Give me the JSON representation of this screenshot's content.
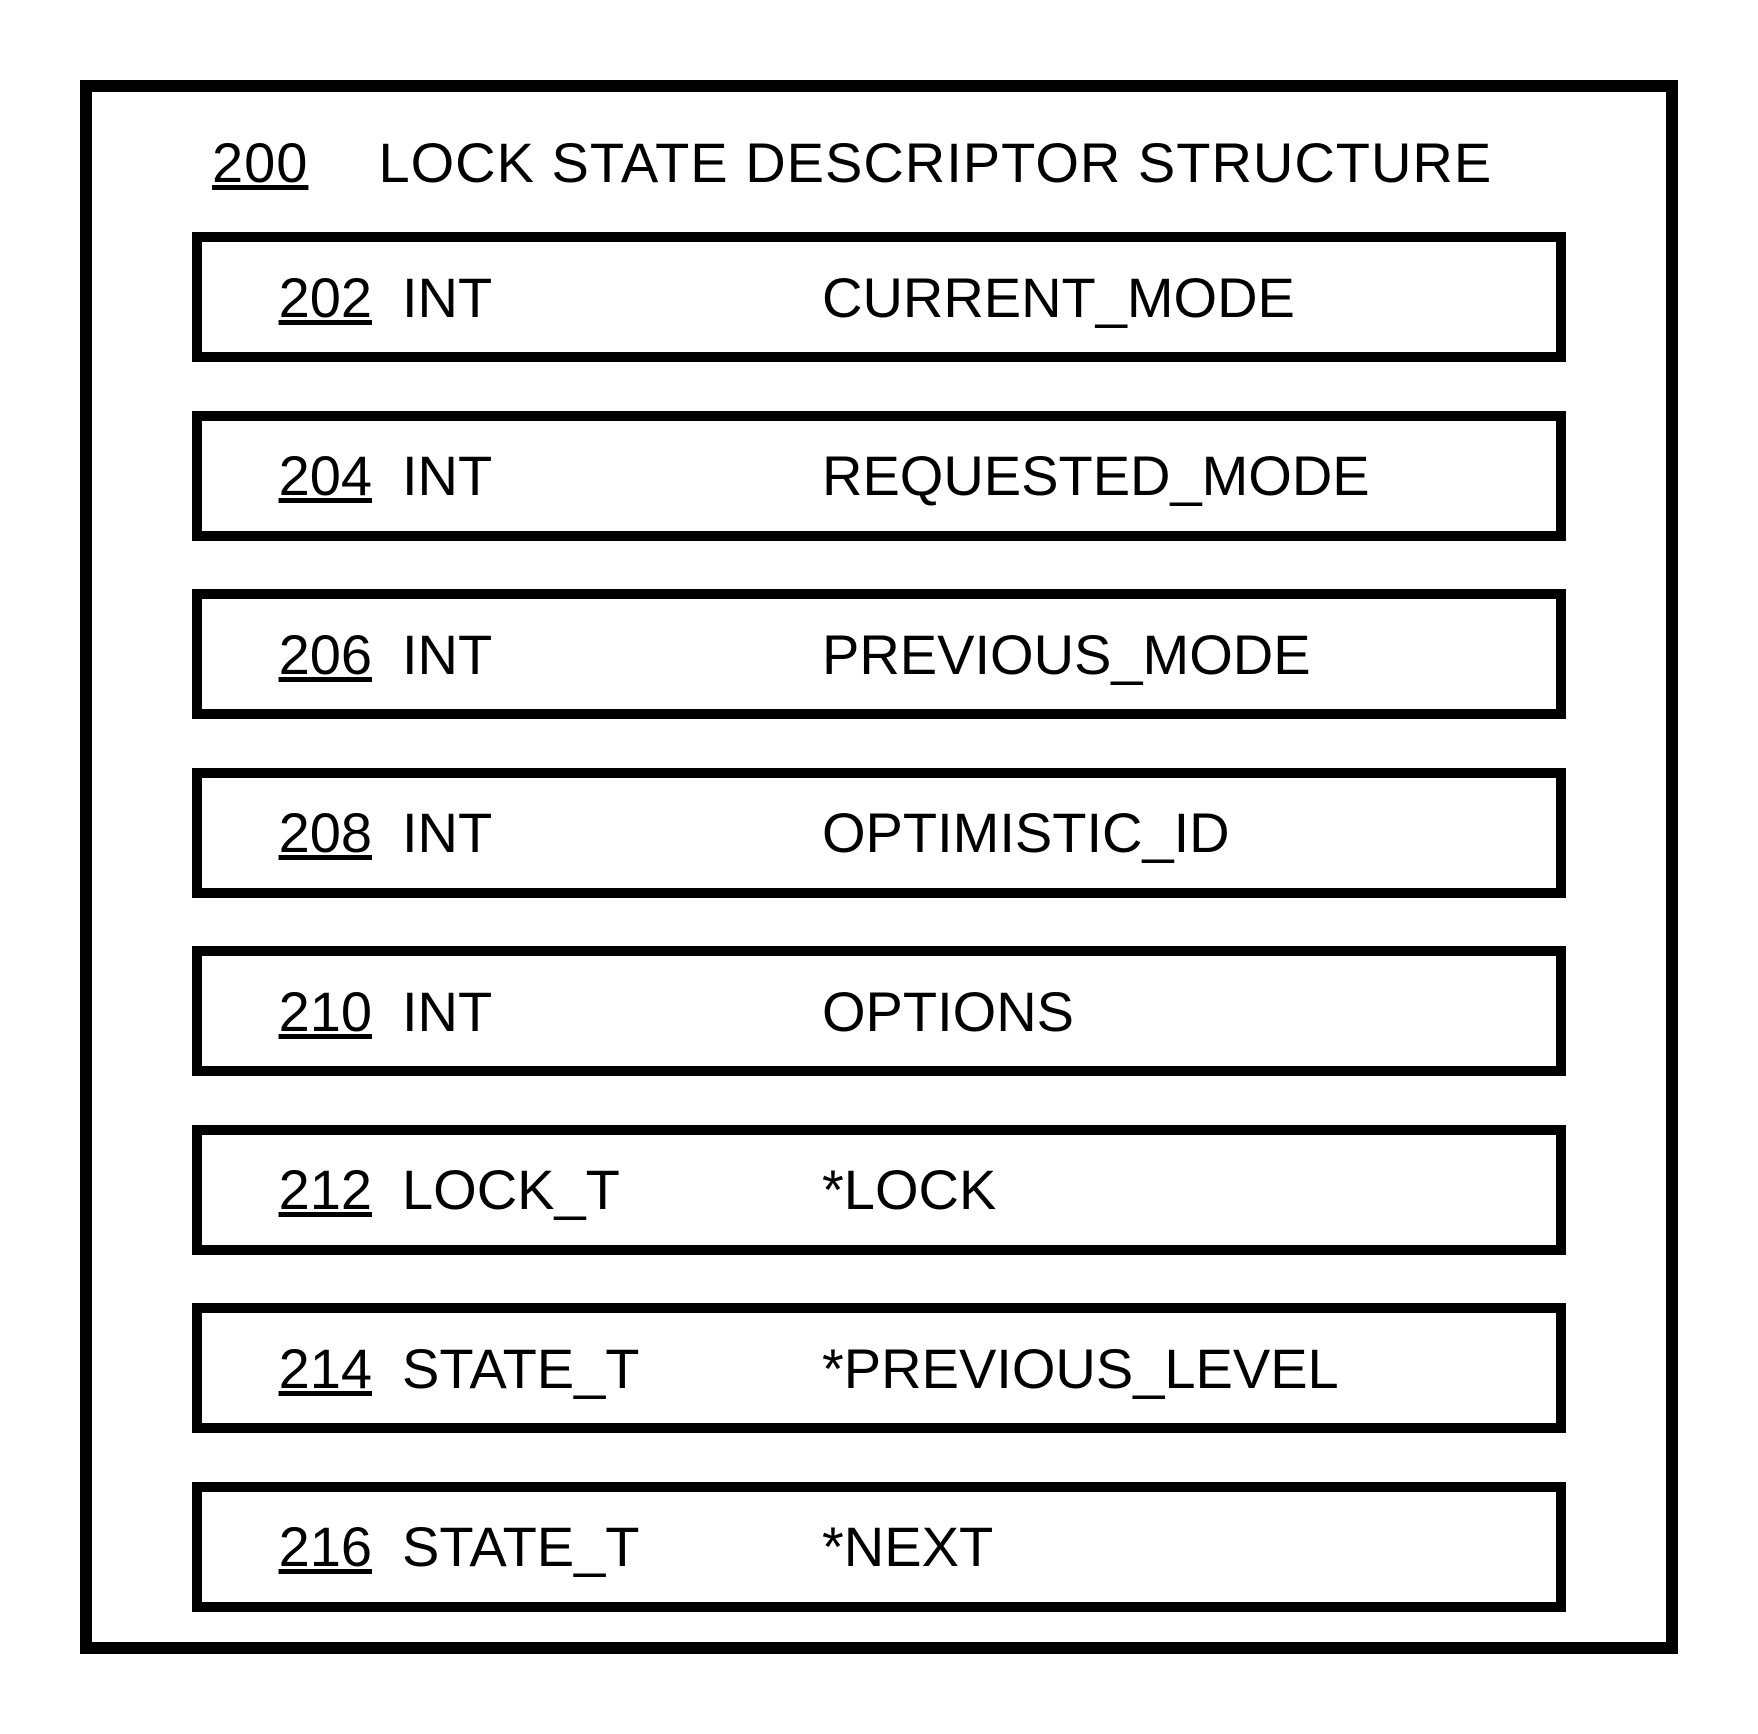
{
  "header": {
    "num": "200",
    "title": "LOCK STATE DESCRIPTOR STRUCTURE"
  },
  "rows": [
    {
      "num": "202",
      "type": "INT",
      "name": "CURRENT_MODE"
    },
    {
      "num": "204",
      "type": "INT",
      "name": "REQUESTED_MODE"
    },
    {
      "num": "206",
      "type": "INT",
      "name": "PREVIOUS_MODE"
    },
    {
      "num": "208",
      "type": "INT",
      "name": "OPTIMISTIC_ID"
    },
    {
      "num": "210",
      "type": "INT",
      "name": "OPTIONS"
    },
    {
      "num": "212",
      "type": "LOCK_T",
      "name": "*LOCK"
    },
    {
      "num": "214",
      "type": "STATE_T",
      "name": "*PREVIOUS_LEVEL"
    },
    {
      "num": "216",
      "type": "STATE_T",
      "name": "*NEXT"
    }
  ]
}
